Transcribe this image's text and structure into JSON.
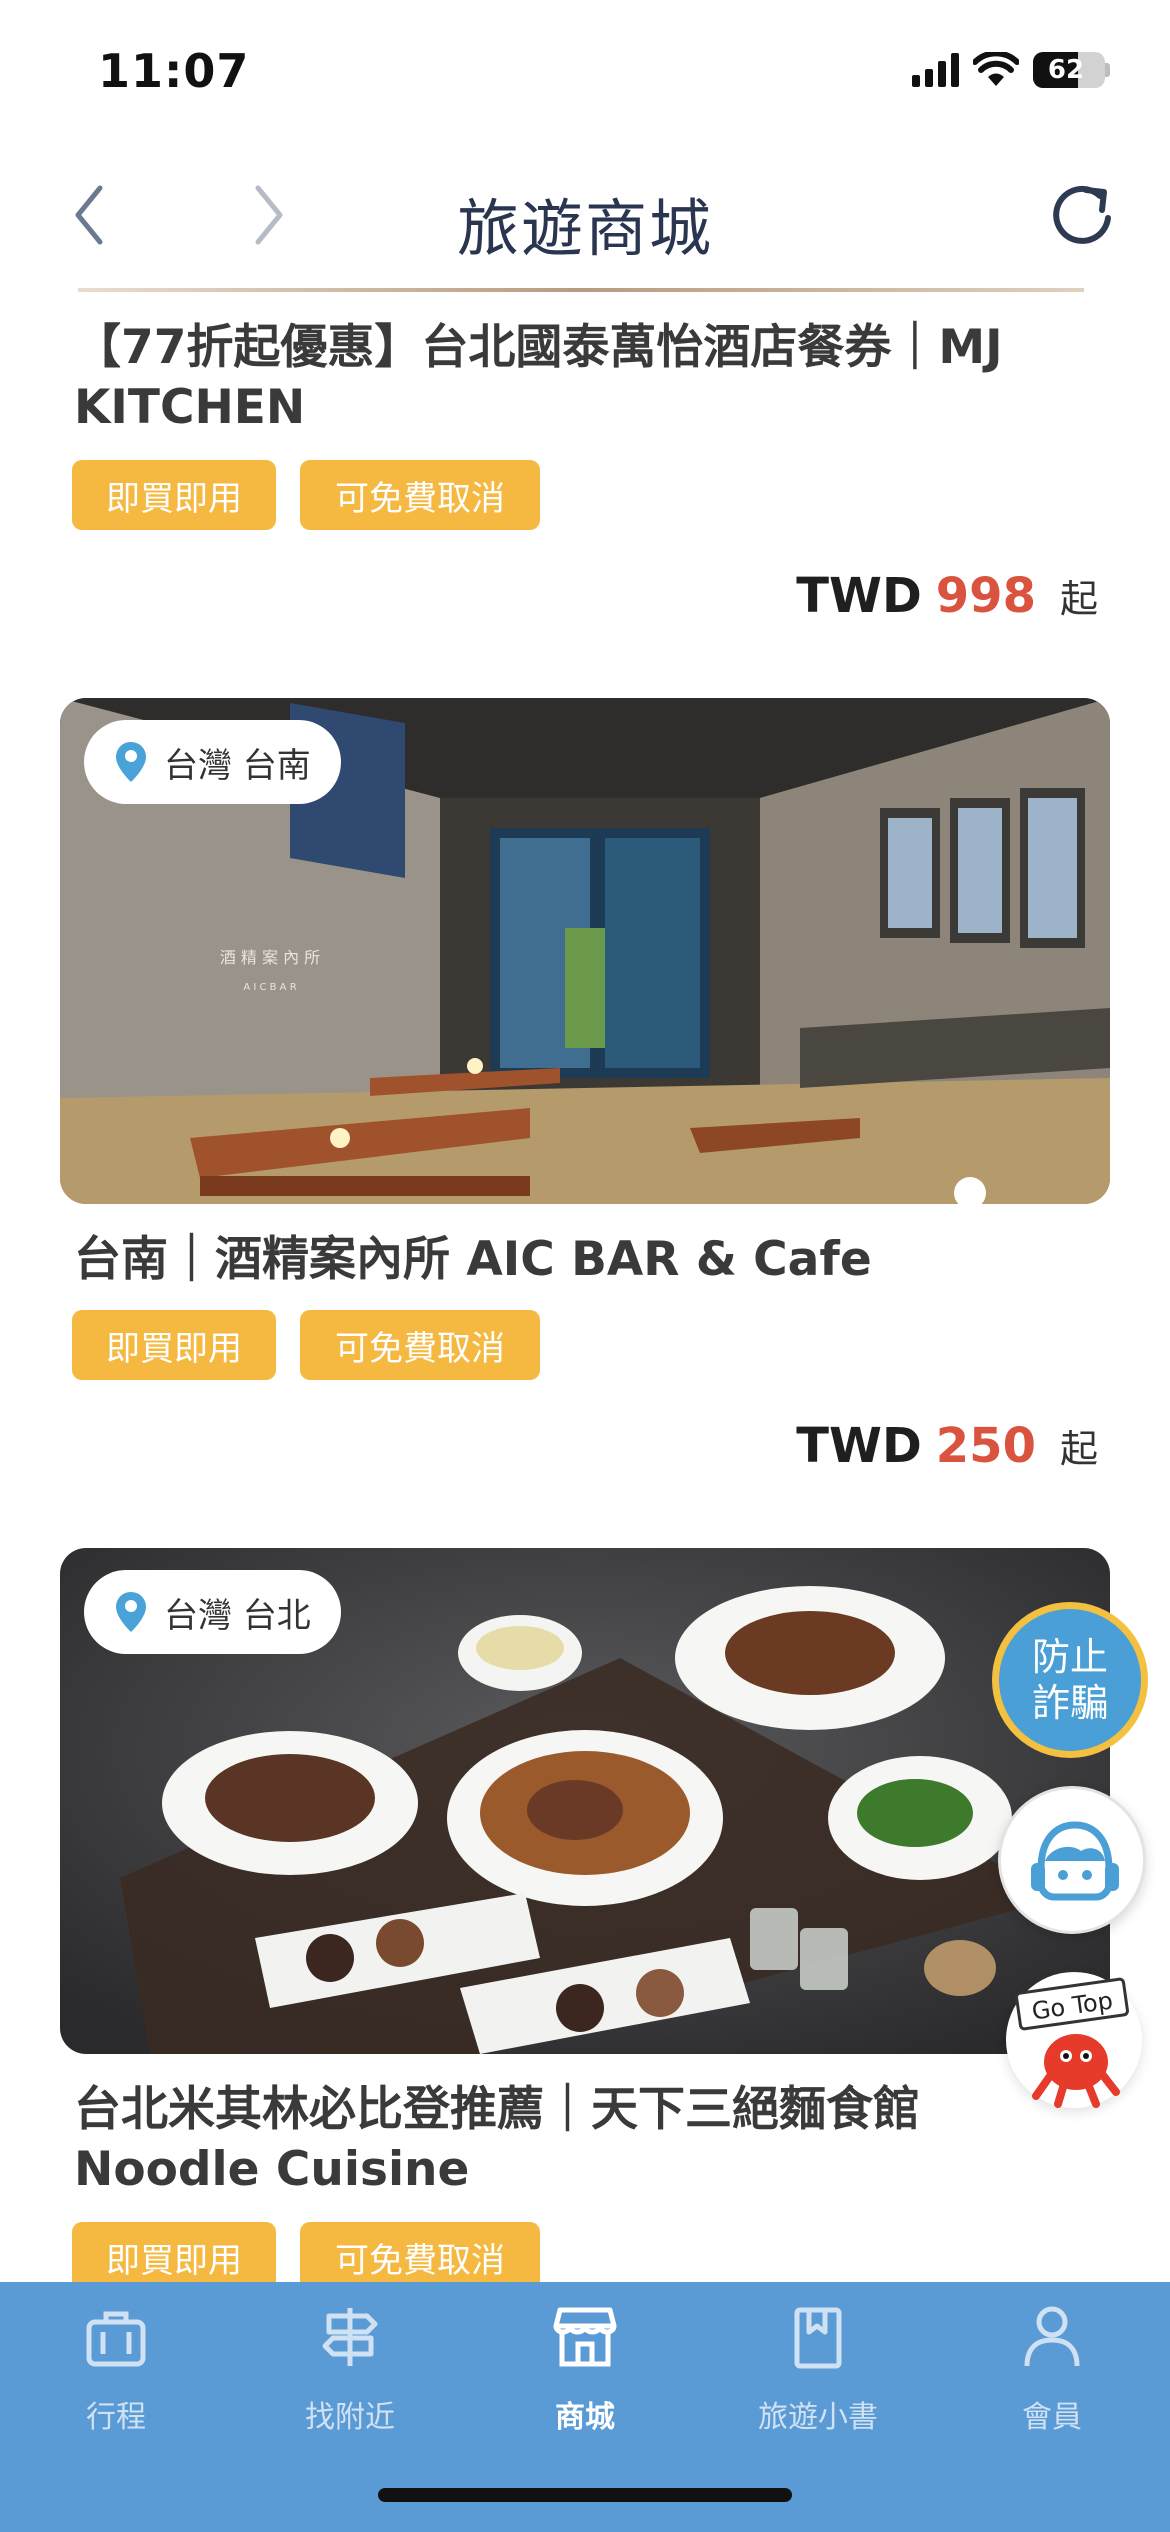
{
  "status": {
    "time": "11:07",
    "battery": "62",
    "battery_level": 0.62
  },
  "header": {
    "title": "旅遊商城"
  },
  "products": [
    {
      "title": "【77折起優惠】台北國泰萬怡酒店餐券｜MJ KITCHEN",
      "tags": [
        "即買即用",
        "可免費取消"
      ],
      "currency": "TWD",
      "price": "998",
      "suffix": "起"
    },
    {
      "location": "台灣 台南",
      "image_text": "酒 精 案 內 所",
      "image_subtext": "A I C   B A R",
      "title": "台南｜酒精案內所 AIC BAR & Cafe",
      "tags": [
        "即買即用",
        "可免費取消"
      ],
      "currency": "TWD",
      "price": "250",
      "suffix": "起"
    },
    {
      "location": "台灣 台北",
      "title": "台北米其林必比登推薦｜天下三絕麵食館 Noodle Cuisine",
      "tags": [
        "即買即用",
        "可免費取消"
      ]
    }
  ],
  "floating": {
    "fraud_line1": "防止",
    "fraud_line2": "詐騙",
    "gotop": "Go Top"
  },
  "tabs": [
    {
      "label": "行程",
      "icon": "suitcase-icon"
    },
    {
      "label": "找附近",
      "icon": "signpost-icon"
    },
    {
      "label": "商城",
      "icon": "store-icon",
      "active": true
    },
    {
      "label": "旅遊小書",
      "icon": "book-icon"
    },
    {
      "label": "會員",
      "icon": "person-icon"
    }
  ],
  "colors": {
    "accent": "#5b9bd5",
    "tag": "#f5b942",
    "price": "#d9533e",
    "title": "#2a3550"
  }
}
